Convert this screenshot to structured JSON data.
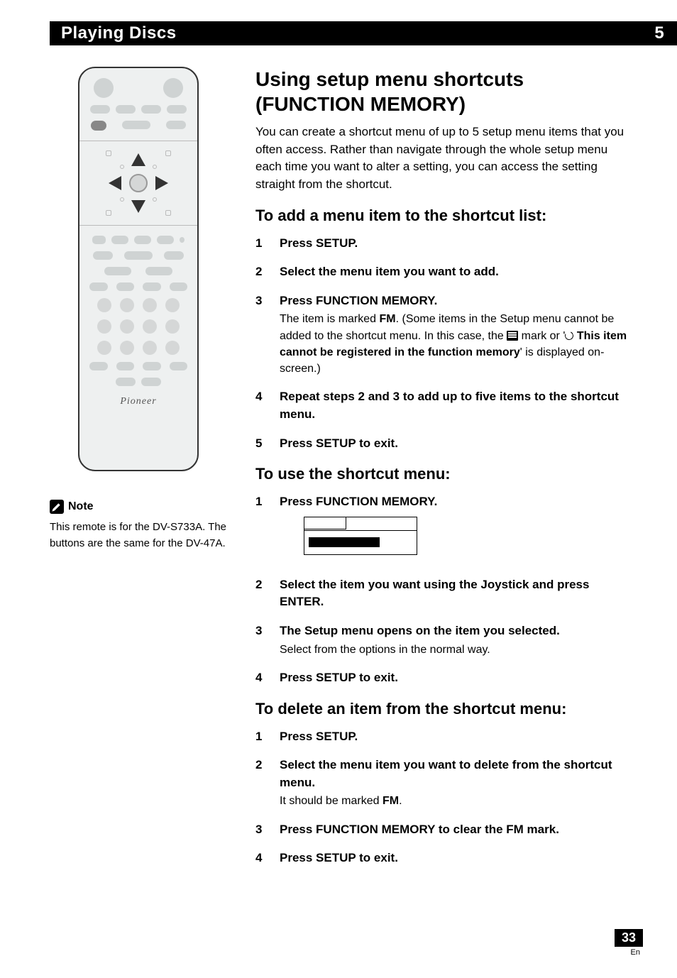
{
  "header": {
    "title": "Playing Discs",
    "chapter": "5"
  },
  "remote": {
    "brand": "Pioneer"
  },
  "note": {
    "label": "Note",
    "text": "This remote is for the DV-S733A. The buttons are the same for the DV-47A."
  },
  "main": {
    "title": "Using setup menu shortcuts (FUNCTION MEMORY)",
    "intro": "You can create a shortcut menu of up to 5 setup menu items that you often access. Rather than navigate through the whole setup menu each time you want to alter a setting, you can access the setting straight from the shortcut.",
    "sectionA": {
      "title": "To add a menu item to the shortcut list:",
      "steps": [
        {
          "n": "1",
          "main": "Press SETUP."
        },
        {
          "n": "2",
          "main": "Select the menu item you want to add."
        },
        {
          "n": "3",
          "main": "Press FUNCTION MEMORY.",
          "sub_pre": "The item is marked ",
          "sub_fm": "FM",
          "sub_mid1": ". (Some items in the Setup menu cannot be added to the shortcut menu. In this case, the ",
          "sub_mid2": " mark or '",
          "sub_bold2": "This item cannot be registered in the function memory",
          "sub_post": "' is displayed on-screen.)"
        },
        {
          "n": "4",
          "main": "Repeat steps 2 and 3 to add up to five items to the shortcut menu."
        },
        {
          "n": "5",
          "main": "Press SETUP to exit."
        }
      ]
    },
    "sectionB": {
      "title": "To use the shortcut menu:",
      "steps": [
        {
          "n": "1",
          "main": "Press FUNCTION MEMORY."
        },
        {
          "n": "2",
          "main": "Select the item you want using the Joystick and press ENTER."
        },
        {
          "n": "3",
          "main": "The Setup menu opens on the item you selected.",
          "sub": "Select from the options in the normal way."
        },
        {
          "n": "4",
          "main": "Press SETUP to exit."
        }
      ]
    },
    "sectionC": {
      "title": "To delete an item from the shortcut menu:",
      "steps": [
        {
          "n": "1",
          "main": "Press SETUP."
        },
        {
          "n": "2",
          "main": "Select the menu item you want to delete from the shortcut menu.",
          "sub_pre": "It should be marked ",
          "sub_fm": "FM",
          "sub_post": "."
        },
        {
          "n": "3",
          "main": "Press FUNCTION MEMORY to clear the FM mark."
        },
        {
          "n": "4",
          "main": "Press SETUP to exit."
        }
      ]
    }
  },
  "footer": {
    "page": "33",
    "lang": "En"
  }
}
